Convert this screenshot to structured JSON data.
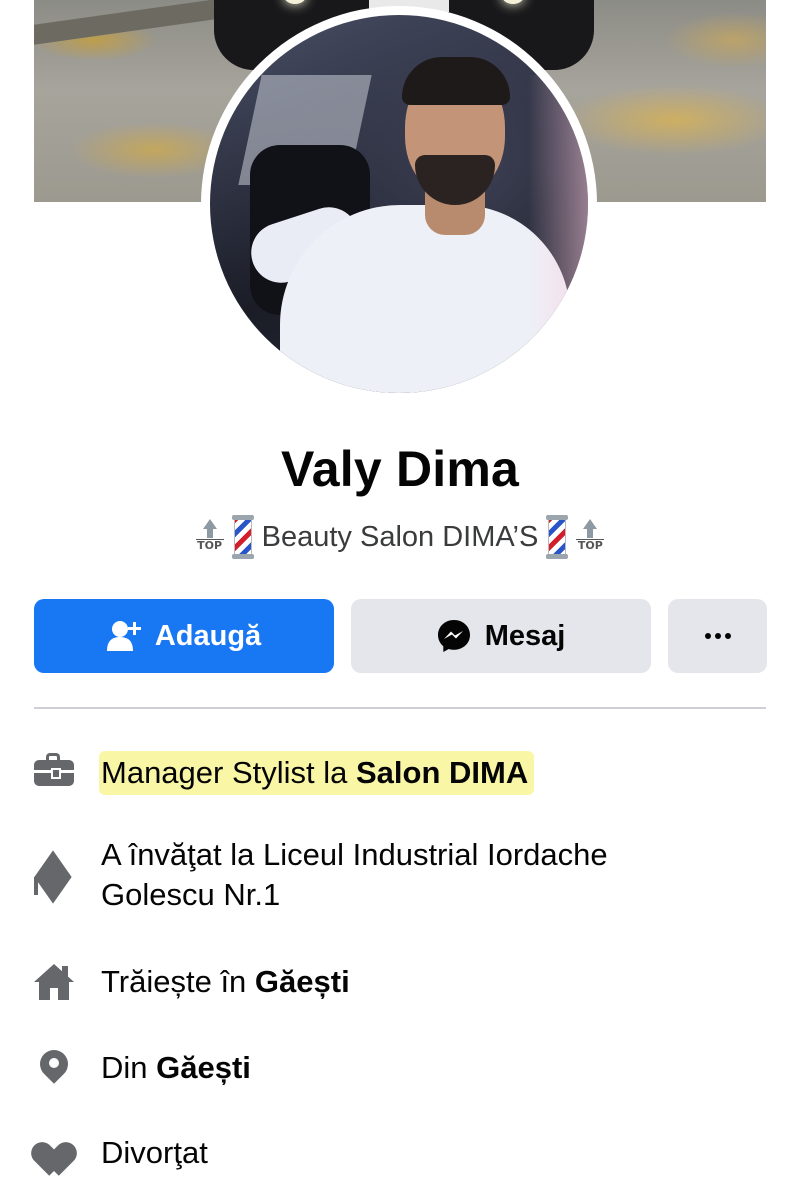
{
  "profile": {
    "name": "Valy Dima",
    "bio_text": "Beauty Salon DIMA’S",
    "top_label": "TOP"
  },
  "actions": {
    "add_label": "Adaugă",
    "message_label": "Mesaj",
    "more_icon": "more-dots-icon"
  },
  "details": {
    "work_prefix": "Manager Stylist la ",
    "work_place": "Salon DIMA",
    "education_text": "A învăţat la Liceul Industrial Iordache Golescu Nr.1",
    "lives_prefix": "Trăiește în ",
    "lives_place": "Găești",
    "from_prefix": "Din ",
    "from_place": "Găești",
    "relationship": "Divorţat"
  },
  "colors": {
    "primary": "#1877f2",
    "secondary_button": "#e4e6eb",
    "icon_gray": "#65676b",
    "highlight": "#f8f496"
  }
}
